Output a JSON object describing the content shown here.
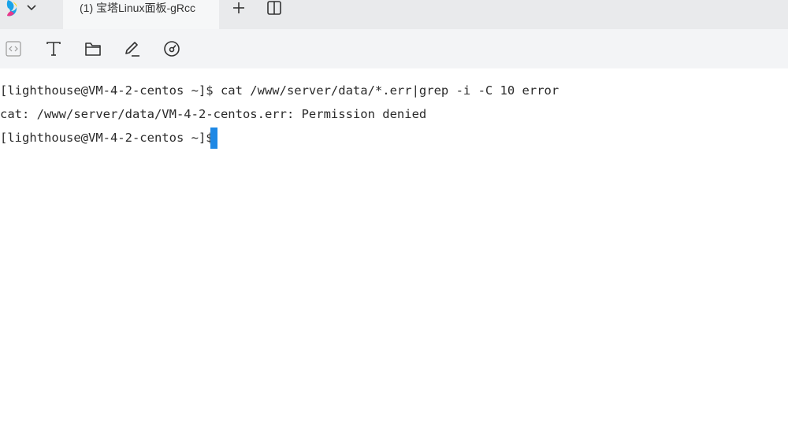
{
  "tabbar": {
    "logo_icon": "app-logo-icon",
    "menu_icon": "chevron-down-icon",
    "active_tab": {
      "title": "(1) 宝塔Linux面板-gRcc"
    },
    "new_tab_icon": "plus-icon",
    "split_icon": "split-view-icon"
  },
  "toolbar": {
    "buttons": [
      {
        "name": "code-icon"
      },
      {
        "name": "text-format-icon"
      },
      {
        "name": "folder-icon"
      },
      {
        "name": "edit-pen-icon"
      },
      {
        "name": "dashboard-gauge-icon"
      }
    ]
  },
  "terminal": {
    "lines": [
      "[lighthouse@VM-4-2-centos ~]$ cat /www/server/data/*.err|grep -i -C 10 error",
      "cat: /www/server/data/VM-4-2-centos.err: Permission denied",
      "[lighthouse@VM-4-2-centos ~]$ "
    ],
    "cursor_color": "#1e88e5"
  },
  "colors": {
    "tabbar_bg": "#e9eaec",
    "toolbar_bg": "#f3f4f6",
    "logo_blue": "#1aa3e8",
    "logo_pink": "#e8388a",
    "logo_yellow": "#ffd400"
  }
}
